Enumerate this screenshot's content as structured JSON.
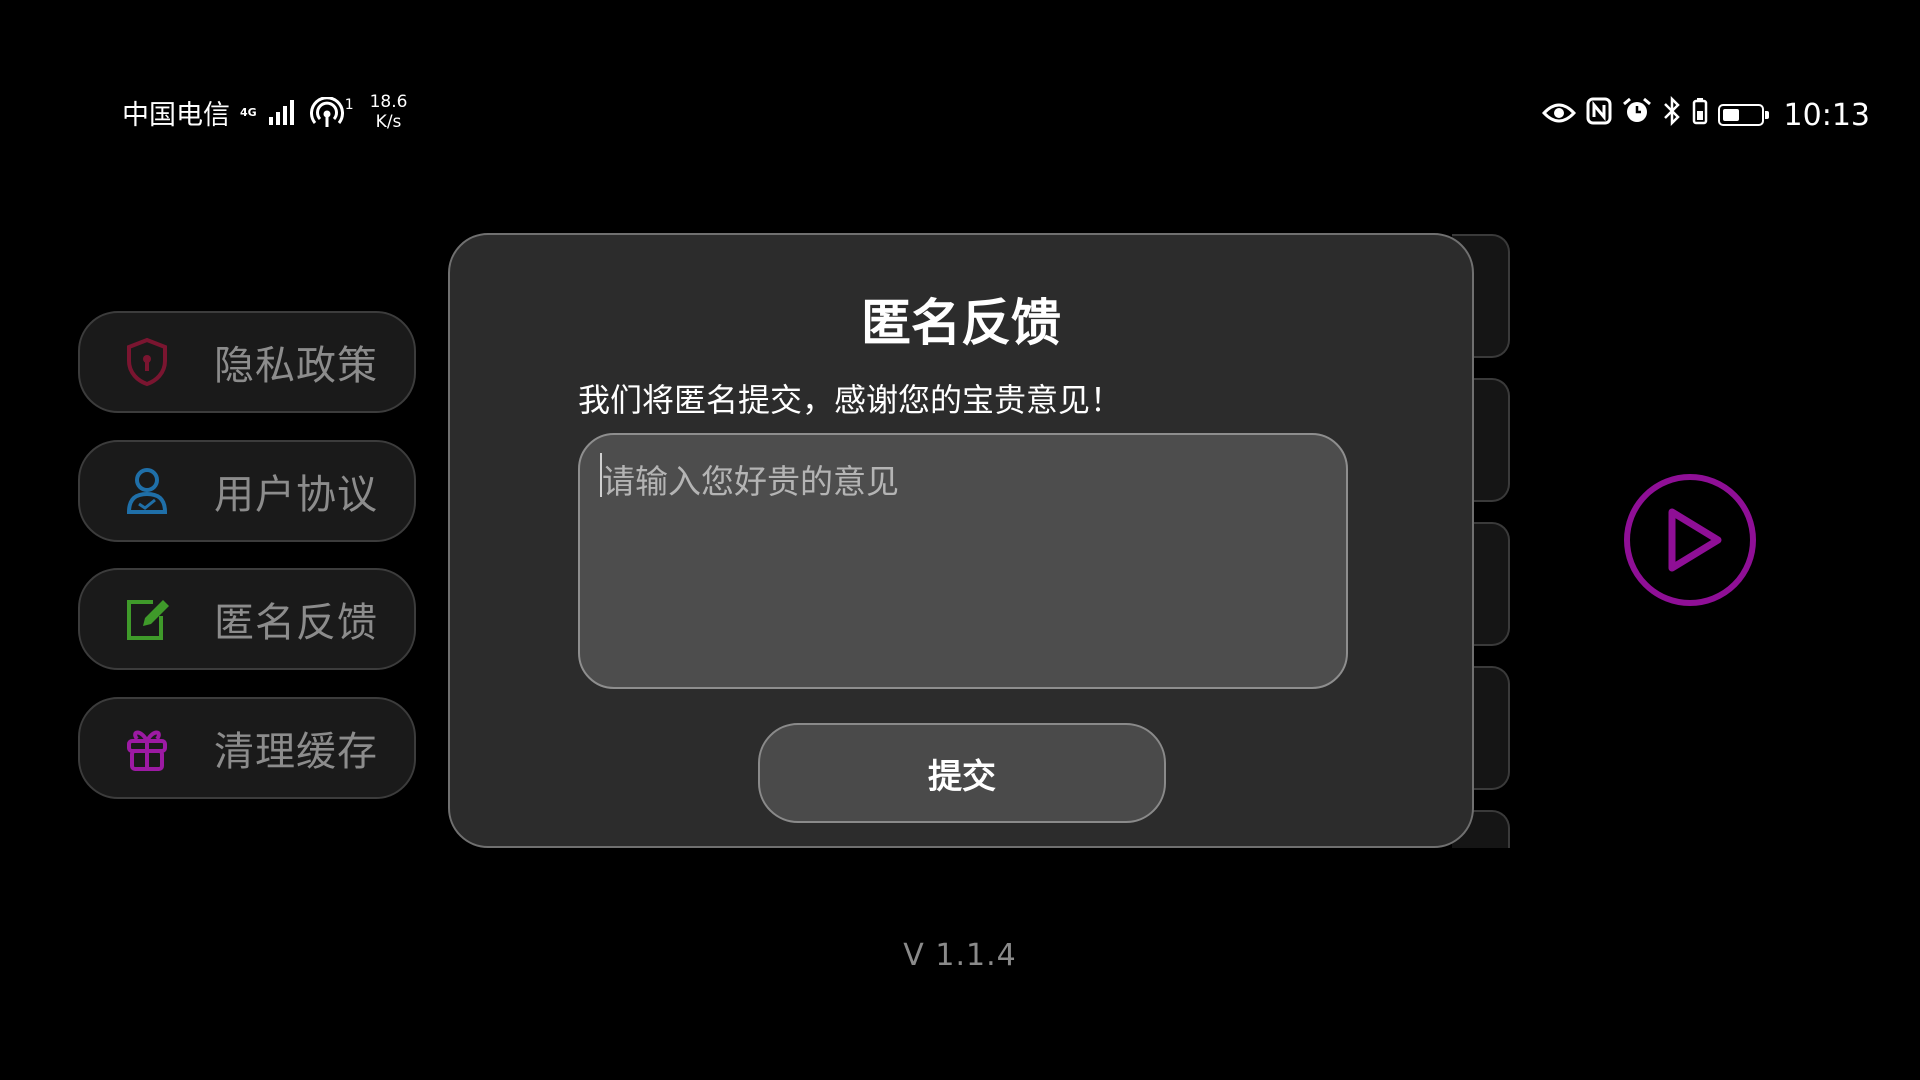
{
  "status_bar": {
    "carrier": "中国电信",
    "network_type": "4G",
    "hotspot_count": "1",
    "speed_value": "18.6",
    "speed_unit": "K/s",
    "time": "10:13",
    "battery_level": 0.45,
    "icons": [
      "eye-icon",
      "nfc-icon",
      "alarm-icon",
      "bluetooth-icon",
      "battery-icon"
    ]
  },
  "menu": {
    "items": [
      {
        "label": "隐私政策",
        "icon": "shield-lock-icon",
        "color": "#7a1530"
      },
      {
        "label": "用户协议",
        "icon": "user-icon",
        "color": "#1f6fa8"
      },
      {
        "label": "匿名反馈",
        "icon": "edit-note-icon",
        "color": "#3f9a2a"
      },
      {
        "label": "清理缓存",
        "icon": "gift-box-icon",
        "color": "#9c1aa3"
      }
    ]
  },
  "dialog": {
    "title": "匿名反馈",
    "description": "我们将匿名提交，感谢您的宝贵意见！",
    "input_placeholder": "请输入您好贵的意见",
    "input_value": "",
    "submit_label": "提交"
  },
  "play_button": {
    "icon": "play-icon",
    "color": "#8f0f96"
  },
  "version": "V 1.1.4"
}
